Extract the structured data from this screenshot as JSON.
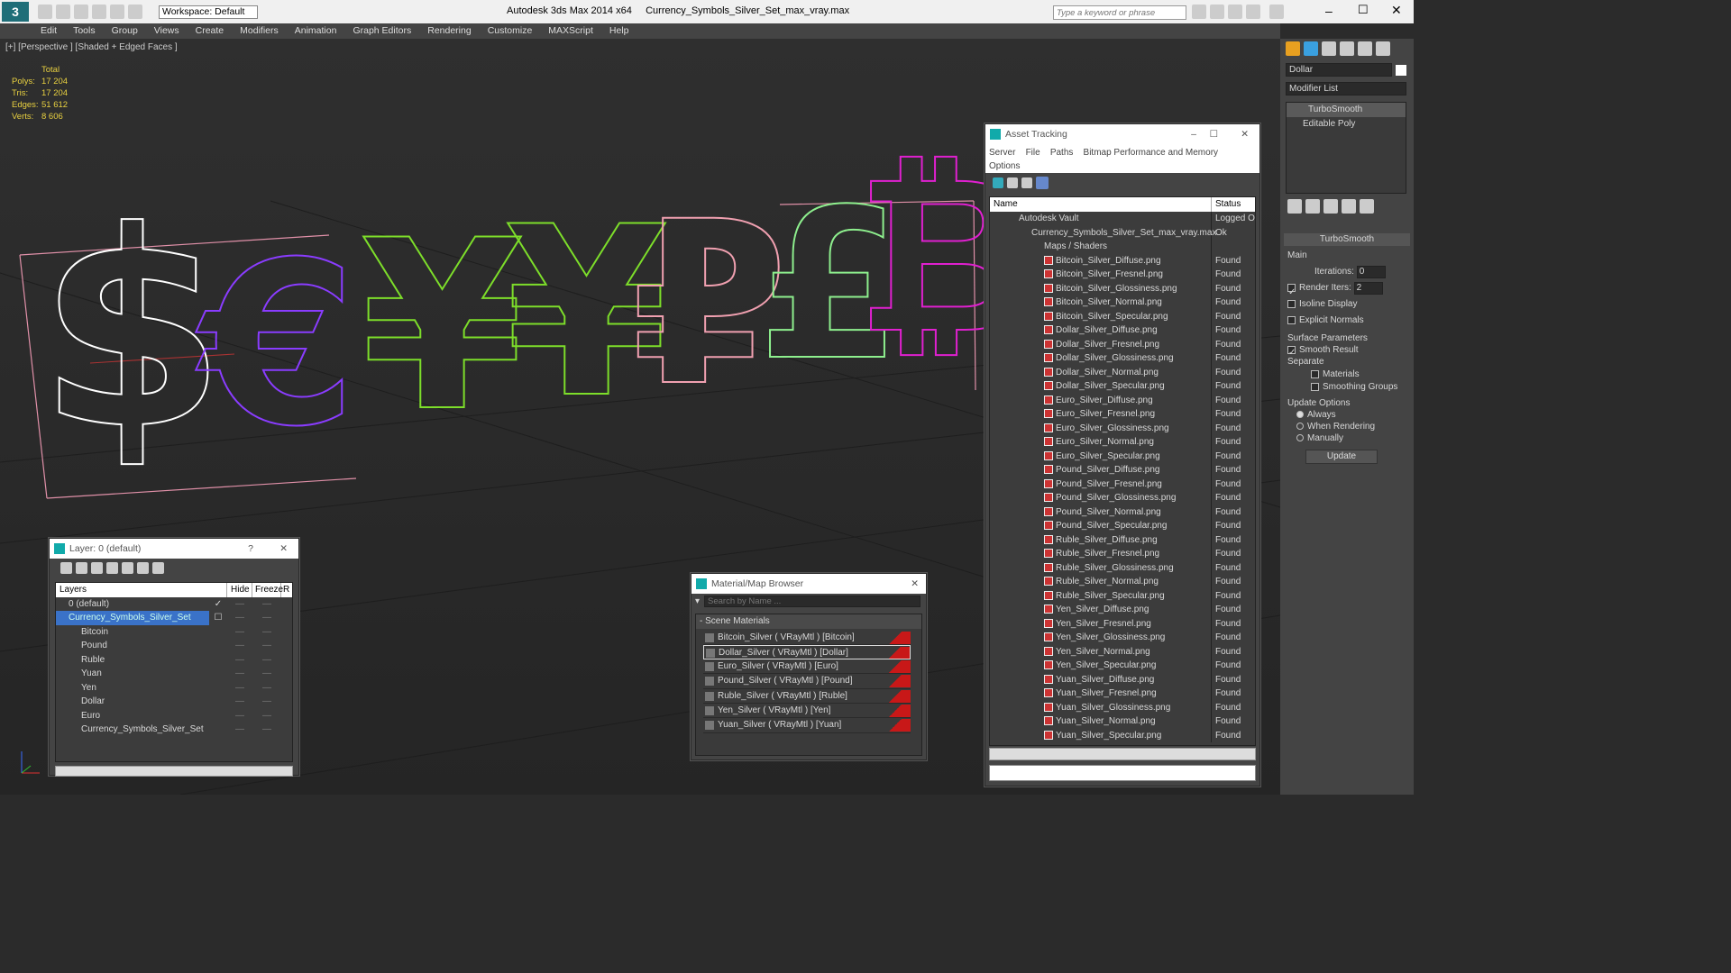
{
  "titlebar": {
    "workspace": "Workspace: Default",
    "app": "Autodesk 3ds Max  2014 x64",
    "file": "Currency_Symbols_Silver_Set_max_vray.max",
    "search_placeholder": "Type a keyword or phrase"
  },
  "menu": [
    "Edit",
    "Tools",
    "Group",
    "Views",
    "Create",
    "Modifiers",
    "Animation",
    "Graph Editors",
    "Rendering",
    "Customize",
    "MAXScript",
    "Help"
  ],
  "viewport": {
    "label": "[+] [Perspective ] [Shaded + Edged Faces ]",
    "stats": {
      "header": "Total",
      "rows": [
        [
          "Polys:",
          "17 204"
        ],
        [
          "Tris:",
          "17 204"
        ],
        [
          "Edges:",
          "51 612"
        ],
        [
          "Verts:",
          "8 606"
        ]
      ]
    }
  },
  "symbols": [
    {
      "glyph": "$",
      "color": "#ffffff"
    },
    {
      "glyph": "€",
      "color": "#8a3cff"
    },
    {
      "glyph": "¥",
      "color": "#7dde2a"
    },
    {
      "glyph": "¥",
      "color": "#7dde2a"
    },
    {
      "glyph": "₽",
      "color": "#f0a0b0"
    },
    {
      "glyph": "£",
      "color": "#8ef08e"
    },
    {
      "glyph": "₿",
      "color": "#e020d0"
    }
  ],
  "asset": {
    "title": "Asset Tracking",
    "menu": [
      "Server",
      "File",
      "Paths",
      "Bitmap Performance and Memory",
      "Options"
    ],
    "col_name": "Name",
    "col_status": "Status",
    "vault": "Autodesk Vault",
    "vault_status": "Logged Ou",
    "file": "Currency_Symbols_Silver_Set_max_vray.max",
    "file_status": "Ok",
    "maps": "Maps / Shaders",
    "files": [
      "Bitcoin_Silver_Diffuse.png",
      "Bitcoin_Silver_Fresnel.png",
      "Bitcoin_Silver_Glossiness.png",
      "Bitcoin_Silver_Normal.png",
      "Bitcoin_Silver_Specular.png",
      "Dollar_Silver_Diffuse.png",
      "Dollar_Silver_Fresnel.png",
      "Dollar_Silver_Glossiness.png",
      "Dollar_Silver_Normal.png",
      "Dollar_Silver_Specular.png",
      "Euro_Silver_Diffuse.png",
      "Euro_Silver_Fresnel.png",
      "Euro_Silver_Glossiness.png",
      "Euro_Silver_Normal.png",
      "Euro_Silver_Specular.png",
      "Pound_Silver_Diffuse.png",
      "Pound_Silver_Fresnel.png",
      "Pound_Silver_Glossiness.png",
      "Pound_Silver_Normal.png",
      "Pound_Silver_Specular.png",
      "Ruble_Silver_Diffuse.png",
      "Ruble_Silver_Fresnel.png",
      "Ruble_Silver_Glossiness.png",
      "Ruble_Silver_Normal.png",
      "Ruble_Silver_Specular.png",
      "Yen_Silver_Diffuse.png",
      "Yen_Silver_Fresnel.png",
      "Yen_Silver_Glossiness.png",
      "Yen_Silver_Normal.png",
      "Yen_Silver_Specular.png",
      "Yuan_Silver_Diffuse.png",
      "Yuan_Silver_Fresnel.png",
      "Yuan_Silver_Glossiness.png",
      "Yuan_Silver_Normal.png",
      "Yuan_Silver_Specular.png"
    ],
    "found": "Found"
  },
  "layer": {
    "title": "Layer: 0 (default)",
    "help": "?",
    "col_layers": "Layers",
    "col_hide": "Hide",
    "col_freeze": "Freeze",
    "col_r": "R",
    "rows": [
      "0 (default)",
      "Currency_Symbols_Silver_Set",
      "Bitcoin",
      "Pound",
      "Ruble",
      "Yuan",
      "Yen",
      "Dollar",
      "Euro",
      "Currency_Symbols_Silver_Set"
    ]
  },
  "matbrowser": {
    "title": "Material/Map Browser",
    "search": "Search by Name ...",
    "section": "- Scene Materials",
    "items": [
      "Bitcoin_Silver  ( VRayMtl ) [Bitcoin]",
      "Dollar_Silver  ( VRayMtl ) [Dollar]",
      "Euro_Silver  ( VRayMtl ) [Euro]",
      "Pound_Silver  ( VRayMtl ) [Pound]",
      "Ruble_Silver  ( VRayMtl ) [Ruble]",
      "Yen_Silver  ( VRayMtl ) [Yen]",
      "Yuan_Silver  ( VRayMtl ) [Yuan]"
    ]
  },
  "cmd": {
    "object": "Dollar",
    "modlist": "Modifier List",
    "stack": [
      "TurboSmooth",
      "Editable Poly"
    ],
    "rollout": "TurboSmooth",
    "main": "Main",
    "iterations_label": "Iterations:",
    "iterations": "0",
    "render_iters_label": "Render Iters:",
    "render_iters": "2",
    "isoline": "Isoline Display",
    "explicit": "Explicit Normals",
    "surface": "Surface Parameters",
    "smooth": "Smooth Result",
    "separate": "Separate",
    "materials": "Materials",
    "smoothing": "Smoothing Groups",
    "update_opts": "Update Options",
    "always": "Always",
    "when_rendering": "When Rendering",
    "manually": "Manually",
    "update": "Update"
  }
}
